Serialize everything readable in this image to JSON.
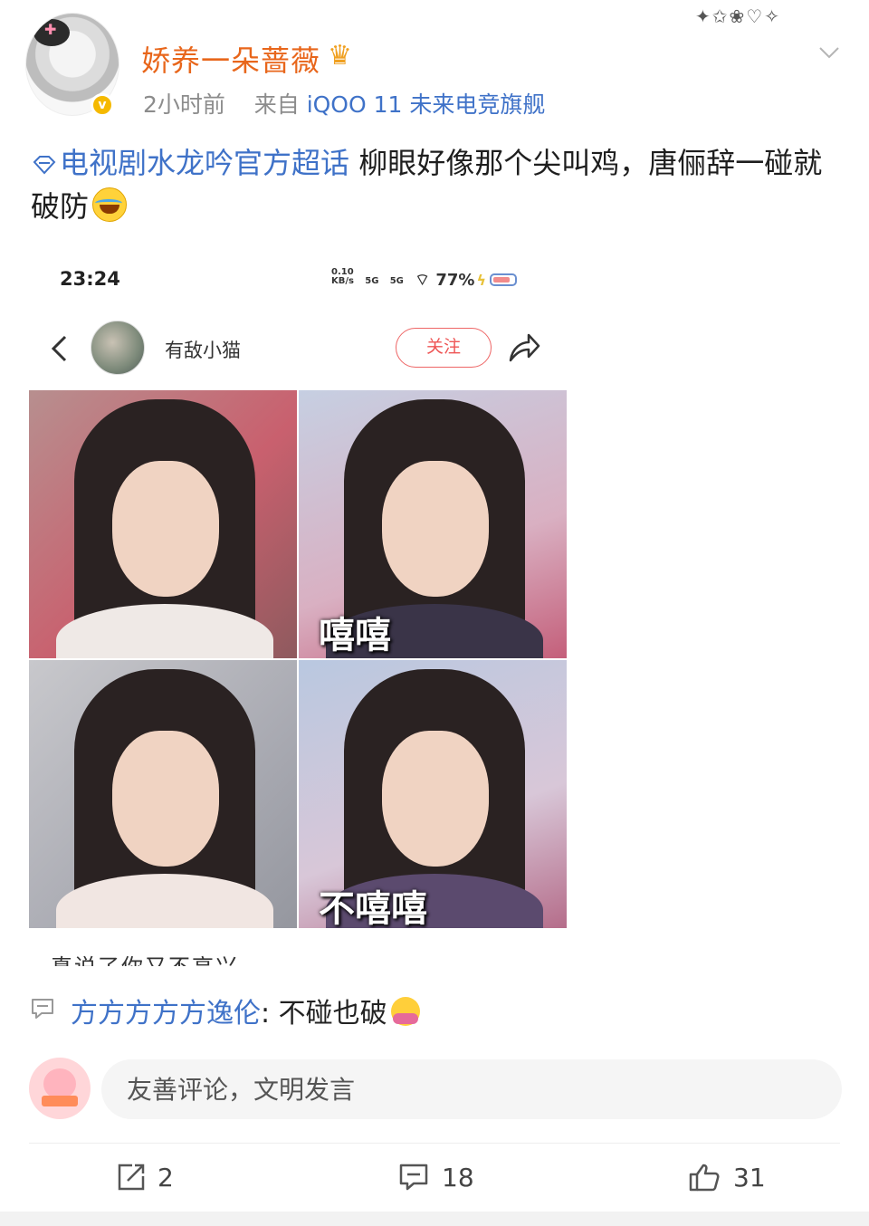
{
  "post": {
    "username": "娇养一朵蔷薇",
    "time": "2小时前",
    "source_prefix": "来自",
    "device": "iQOO 11 未来电竞旗舰",
    "topic": "电视剧水龙吟官方超话",
    "text": " 柳眼好像那个尖叫鸡，唐俪辞一碰就破防"
  },
  "embedded": {
    "time": "23:24",
    "speed_value": "0.10",
    "speed_unit": "KB/s",
    "net1": "5G",
    "net2": "5G",
    "battery": "77%",
    "user": "有敌小猫",
    "follow_label": "关注",
    "caption_top": "嘻嘻",
    "caption_bottom": "不嘻嘻",
    "cut_text": "真说了你又不高兴"
  },
  "comment_preview": {
    "author": "方方方方方逸伦",
    "separator": ": ",
    "text": "不碰也破"
  },
  "comment_input": {
    "placeholder": "友善评论，文明发言"
  },
  "actions": {
    "reposts": "2",
    "comments": "18",
    "likes": "31"
  },
  "colors": {
    "link": "#3f72c8",
    "username": "#e8661b",
    "follow": "#e55555"
  }
}
